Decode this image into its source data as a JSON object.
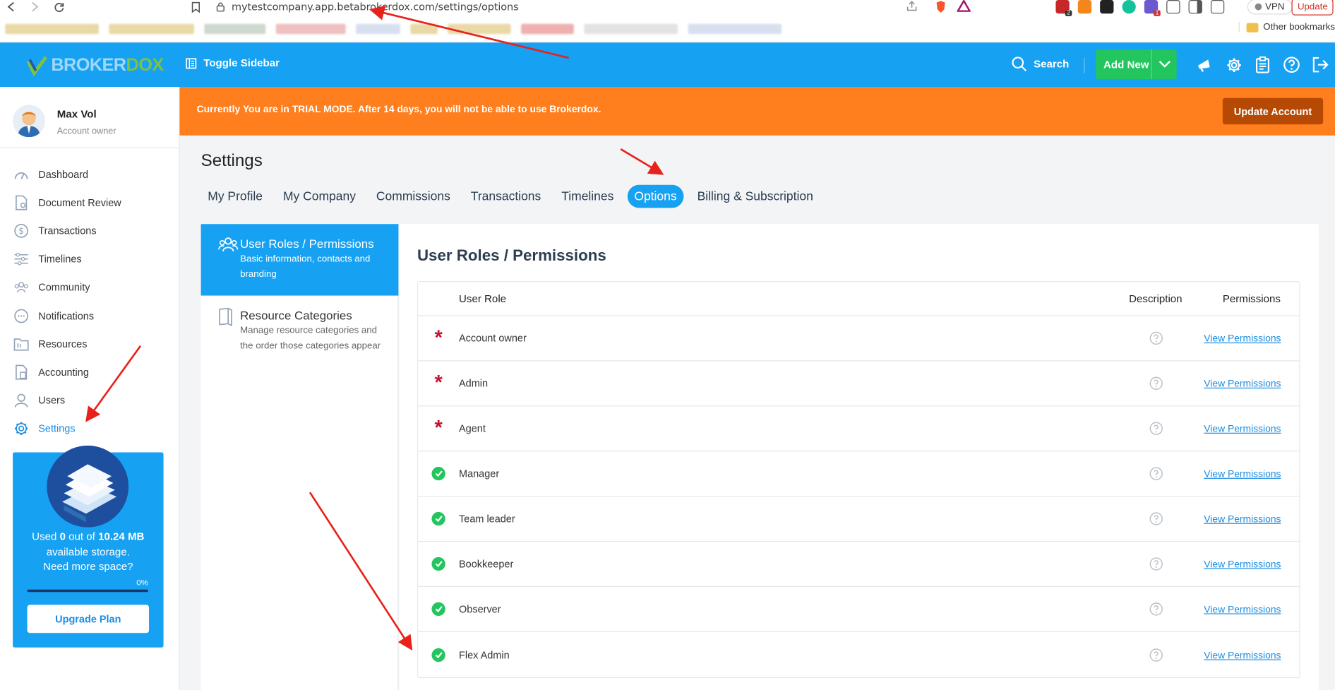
{
  "browser": {
    "url": "mytestcompany.app.betabrokerdox.com/settings/options",
    "vpn_label": "VPN",
    "update_label": "Update",
    "other_bookmarks": "Other bookmarks",
    "extension_badges": [
      "2",
      "1"
    ]
  },
  "topbar": {
    "logo_part1": "BROKER",
    "logo_part2": "DOX",
    "toggle_label": "Toggle Sidebar",
    "search_label": "Search",
    "add_new_label": "Add New"
  },
  "user": {
    "name": "Max Vol",
    "role": "Account owner"
  },
  "sidebar": {
    "items": [
      {
        "label": "Dashboard",
        "icon": "dashboard-icon"
      },
      {
        "label": "Document Review",
        "icon": "document-review-icon"
      },
      {
        "label": "Transactions",
        "icon": "transactions-icon"
      },
      {
        "label": "Timelines",
        "icon": "timelines-icon"
      },
      {
        "label": "Community",
        "icon": "community-icon"
      },
      {
        "label": "Notifications",
        "icon": "notifications-icon"
      },
      {
        "label": "Resources",
        "icon": "resources-icon"
      },
      {
        "label": "Accounting",
        "icon": "accounting-icon"
      },
      {
        "label": "Users",
        "icon": "users-icon"
      },
      {
        "label": "Settings",
        "icon": "settings-icon",
        "active": true
      }
    ]
  },
  "storage": {
    "used_prefix": "Used ",
    "used_value": "0",
    "used_mid": " out of ",
    "total_value": "10.24 MB",
    "line2": "available storage.",
    "line3": "Need more space?",
    "percent_label": "0%",
    "percent_value": 0,
    "upgrade_label": "Upgrade Plan"
  },
  "trial": {
    "message": "Currently You are in TRIAL MODE. After 14 days, you will not be able to use Brokerdox.",
    "button_label": "Update Account"
  },
  "page": {
    "title": "Settings",
    "tabs": [
      "My Profile",
      "My Company",
      "Commissions",
      "Transactions",
      "Timelines",
      "Options",
      "Billing & Subscription"
    ],
    "active_tab": "Options"
  },
  "options_menu": [
    {
      "title": "User Roles / Permissions",
      "desc": "Basic information, contacts and branding"
    },
    {
      "title": "Resource Categories",
      "desc": "Manage resource categories and the order those categories appear"
    }
  ],
  "content": {
    "title": "User Roles / Permissions",
    "headers": {
      "role": "User Role",
      "description": "Description",
      "permissions": "Permissions"
    },
    "rows": [
      {
        "role": "Account owner",
        "marker": "required",
        "link": "View Permissions"
      },
      {
        "role": "Admin",
        "marker": "required",
        "link": "View Permissions"
      },
      {
        "role": "Agent",
        "marker": "required",
        "link": "View Permissions"
      },
      {
        "role": "Manager",
        "marker": "enabled",
        "link": "View Permissions"
      },
      {
        "role": "Team leader",
        "marker": "enabled",
        "link": "View Permissions"
      },
      {
        "role": "Bookkeeper",
        "marker": "enabled",
        "link": "View Permissions"
      },
      {
        "role": "Observer",
        "marker": "enabled",
        "link": "View Permissions"
      },
      {
        "role": "Flex Admin",
        "marker": "enabled",
        "link": "View Permissions"
      }
    ]
  },
  "colors": {
    "brand_blue": "#16a1f2",
    "trial_orange": "#ff7e1d",
    "add_green": "#22c55e",
    "required_red": "#c8102e",
    "annotation_red": "#e8211a"
  }
}
